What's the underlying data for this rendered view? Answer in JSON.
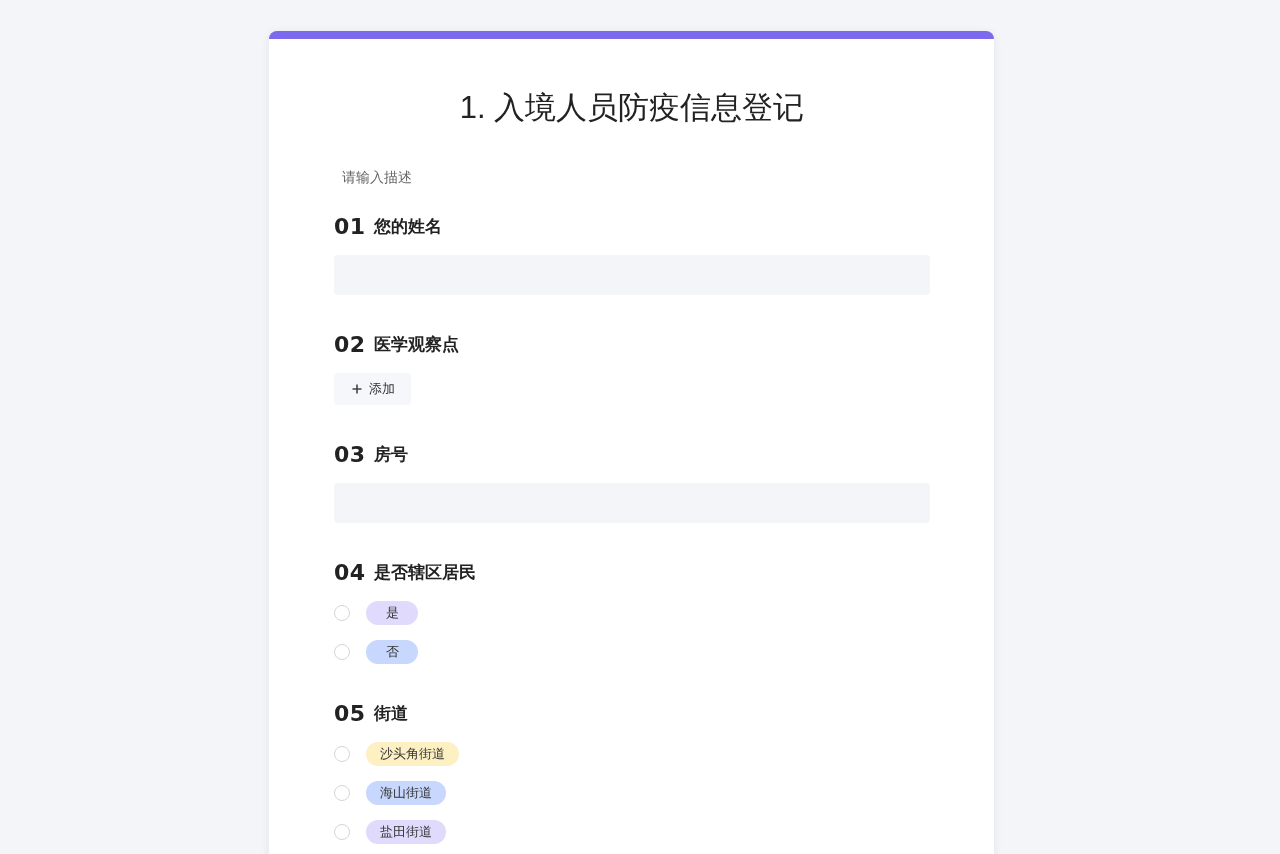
{
  "form": {
    "title": "1. 入境人员防疫信息登记",
    "description": "请输入描述"
  },
  "questions": [
    {
      "number": "01",
      "label": "您的姓名",
      "kind": "text"
    },
    {
      "number": "02",
      "label": "医学观察点",
      "kind": "add",
      "button": "添加"
    },
    {
      "number": "03",
      "label": "房号",
      "kind": "text"
    },
    {
      "number": "04",
      "label": "是否辖区居民",
      "kind": "choice",
      "options": [
        {
          "label": "是",
          "color": "#e0dafd",
          "selected": false
        },
        {
          "label": "否",
          "color": "#c8d7fd",
          "selected": false
        }
      ]
    },
    {
      "number": "05",
      "label": "街道",
      "kind": "choice",
      "options": [
        {
          "label": "沙头角街道",
          "color": "#fdf0c2",
          "selected": false
        },
        {
          "label": "海山街道",
          "color": "#c8d7fd",
          "selected": false
        },
        {
          "label": "盐田街道",
          "color": "#e0dafd",
          "selected": false
        }
      ]
    }
  ]
}
